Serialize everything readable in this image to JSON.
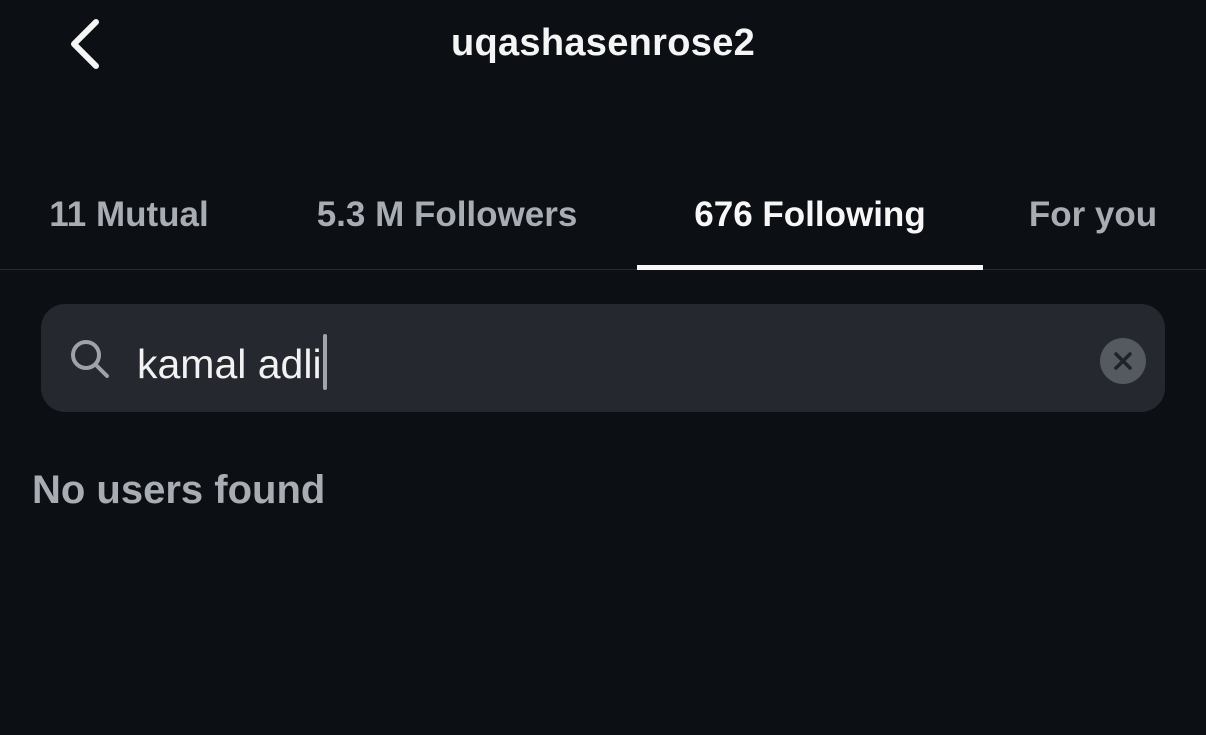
{
  "header": {
    "title": "uqashasenrose2",
    "back_icon": "chevron-left-icon"
  },
  "tabs": [
    {
      "label": "11 Mutual",
      "active": false
    },
    {
      "label": "5.3 M Followers",
      "active": false
    },
    {
      "label": "676 Following",
      "active": true
    },
    {
      "label": "For you",
      "active": false
    }
  ],
  "search": {
    "value": "kamal adli",
    "search_icon": "search-icon",
    "clear_icon": "clear-icon"
  },
  "results": {
    "empty_message": "No users found"
  },
  "colors": {
    "background": "#0c0f14",
    "search_bg": "#25282e",
    "active_text": "#f7f7f7",
    "inactive_text": "#a8acb3"
  }
}
